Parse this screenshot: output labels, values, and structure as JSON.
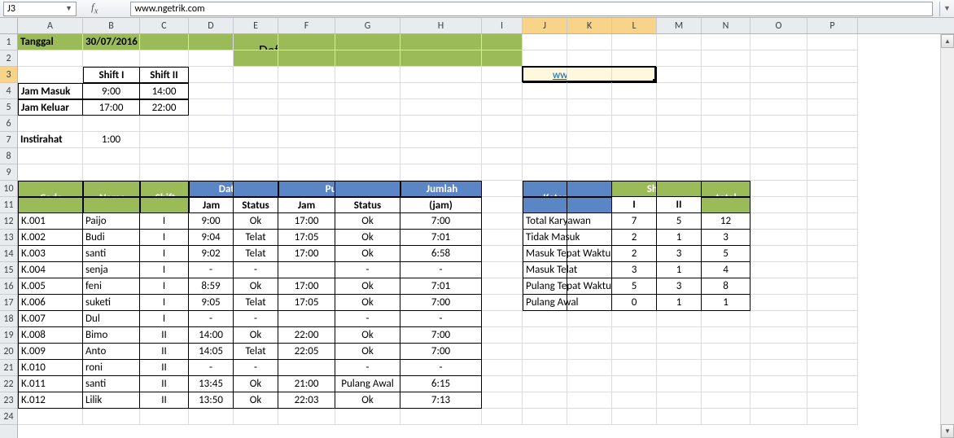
{
  "namebox": "J3",
  "formula": "www.ngetrik.com",
  "columns": [
    {
      "l": "A",
      "w": 80
    },
    {
      "l": "B",
      "w": 70
    },
    {
      "l": "C",
      "w": 60
    },
    {
      "l": "D",
      "w": 55
    },
    {
      "l": "E",
      "w": 55
    },
    {
      "l": "F",
      "w": 70
    },
    {
      "l": "G",
      "w": 80
    },
    {
      "l": "H",
      "w": 100
    },
    {
      "l": "I",
      "w": 50
    },
    {
      "l": "J",
      "w": 55,
      "sel": true
    },
    {
      "l": "K",
      "w": 55,
      "sel": true
    },
    {
      "l": "L",
      "w": 55,
      "sel": true
    },
    {
      "l": "M",
      "w": 55
    },
    {
      "l": "N",
      "w": 60
    },
    {
      "l": "O",
      "w": 70
    },
    {
      "l": "P",
      "w": 62
    }
  ],
  "rows": 24,
  "sel_row": 3,
  "tanggal_label": "Tanggal",
  "tanggal_value": "30/07/2016",
  "title": "Daftar absensi Karyawaan Maju Mundur",
  "link_text": "www.ngetrik.com",
  "shift_header": {
    "s1": "Shift I",
    "s2": "Shift II"
  },
  "jam_masuk": {
    "label": "Jam Masuk",
    "s1": "9:00",
    "s2": "14:00"
  },
  "jam_keluar": {
    "label": "Jam Keluar",
    "s1": "17:00",
    "s2": "22:00"
  },
  "istirahat": {
    "label": "Instirahat",
    "val": "1:00"
  },
  "table_headers": {
    "code": "Code",
    "name": "Name",
    "shift": "Shift",
    "datang": "Datang",
    "pulang": "Pulang",
    "jumlah": "Jumlah",
    "jam": "Jam",
    "status": "Status",
    "jamunit": "(jam)"
  },
  "table_rows": [
    {
      "code": "K.001",
      "name": "Paijo",
      "shift": "I",
      "d_jam": "9:00",
      "d_st": "Ok",
      "p_jam": "17:00",
      "p_st": "Ok",
      "jml": "7:00"
    },
    {
      "code": "K.002",
      "name": "Budi",
      "shift": "I",
      "d_jam": "9:04",
      "d_st": "Telat",
      "p_jam": "17:05",
      "p_st": "Ok",
      "jml": "7:01"
    },
    {
      "code": "K.003",
      "name": "santi",
      "shift": "I",
      "d_jam": "9:02",
      "d_st": "Telat",
      "p_jam": "17:00",
      "p_st": "Ok",
      "jml": "6:58"
    },
    {
      "code": "K.004",
      "name": "senja",
      "shift": "I",
      "d_jam": "-",
      "d_st": "-",
      "p_jam": "",
      "p_st": "-",
      "jml": "-"
    },
    {
      "code": "K.005",
      "name": "feni",
      "shift": "I",
      "d_jam": "8:59",
      "d_st": "Ok",
      "p_jam": "17:00",
      "p_st": "Ok",
      "jml": "7:01"
    },
    {
      "code": "K.006",
      "name": "suketi",
      "shift": "I",
      "d_jam": "9:05",
      "d_st": "Telat",
      "p_jam": "17:05",
      "p_st": "Ok",
      "jml": "7:00"
    },
    {
      "code": "K.007",
      "name": "Dul",
      "shift": "I",
      "d_jam": "-",
      "d_st": "-",
      "p_jam": "",
      "p_st": "-",
      "jml": "-"
    },
    {
      "code": "K.008",
      "name": "Bimo",
      "shift": "II",
      "d_jam": "14:00",
      "d_st": "Ok",
      "p_jam": "22:00",
      "p_st": "Ok",
      "jml": "7:00"
    },
    {
      "code": "K.009",
      "name": "Anto",
      "shift": "II",
      "d_jam": "14:05",
      "d_st": "Telat",
      "p_jam": "22:05",
      "p_st": "Ok",
      "jml": "7:00"
    },
    {
      "code": "K.010",
      "name": "roni",
      "shift": "II",
      "d_jam": "-",
      "d_st": "-",
      "p_jam": "",
      "p_st": "-",
      "jml": "-"
    },
    {
      "code": "K.011",
      "name": "santi",
      "shift": "II",
      "d_jam": "13:45",
      "d_st": "Ok",
      "p_jam": "21:00",
      "p_st": "Pulang Awal",
      "jml": "6:15"
    },
    {
      "code": "K.012",
      "name": "Lilik",
      "shift": "II",
      "d_jam": "13:50",
      "d_st": "Ok",
      "p_jam": "22:03",
      "p_st": "Ok",
      "jml": "7:13"
    }
  ],
  "summary_headers": {
    "ket": "Keterangan",
    "shift": "Shift",
    "s1": "I",
    "s2": "II",
    "total": "total"
  },
  "summary_rows": [
    {
      "k": "Total Karyawan",
      "s1": "7",
      "s2": "5",
      "t": "12"
    },
    {
      "k": "Tidak Masuk",
      "s1": "2",
      "s2": "1",
      "t": "3"
    },
    {
      "k": "Masuk Tepat Waktu",
      "s1": "2",
      "s2": "3",
      "t": "5"
    },
    {
      "k": "Masuk Telat",
      "s1": "3",
      "s2": "1",
      "t": "4"
    },
    {
      "k": "Pulang Tepat Waktu",
      "s1": "5",
      "s2": "3",
      "t": "8"
    },
    {
      "k": "Pulang Awal",
      "s1": "0",
      "s2": "1",
      "t": "1"
    }
  ]
}
